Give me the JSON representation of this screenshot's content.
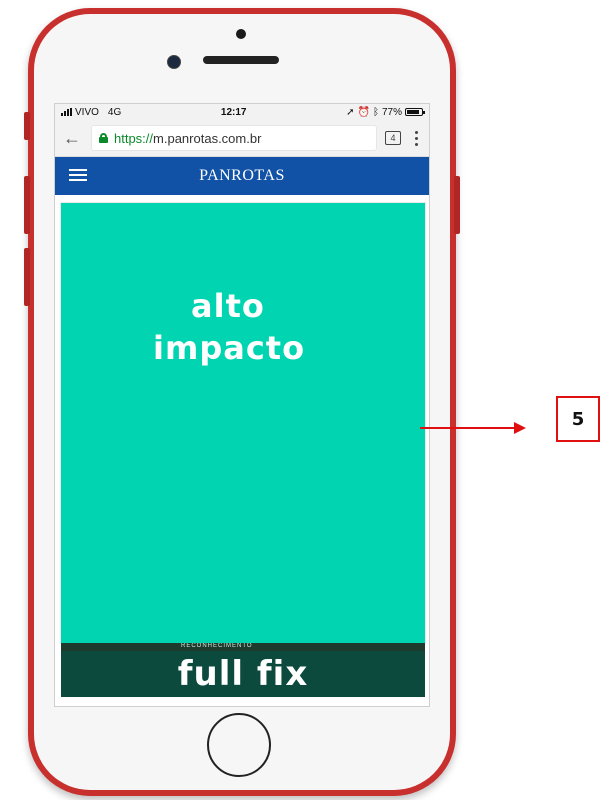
{
  "status_bar": {
    "carrier": "VIVO",
    "network": "4G",
    "time": "12:17",
    "battery": "77%",
    "icons": [
      "location-icon",
      "alarm-icon",
      "bluetooth-icon",
      "battery-icon"
    ]
  },
  "browser": {
    "url_scheme": "https://",
    "url_host": "m.panrotas.com.br",
    "tab_count": "4"
  },
  "site": {
    "brand": "PANROTAS"
  },
  "ad": {
    "line1": "alto",
    "line2": "impacto",
    "background_color": "#00d4b0"
  },
  "background_teaser": {
    "text": "RECONHECIMENTO"
  },
  "fixed_bar": {
    "label": "full fix"
  },
  "annotation": {
    "number": "5",
    "color": "#e01010"
  },
  "colors": {
    "phone_frame": "#c8302e",
    "header": "#1252a6",
    "fixed_bar": "#0b4a3d"
  }
}
